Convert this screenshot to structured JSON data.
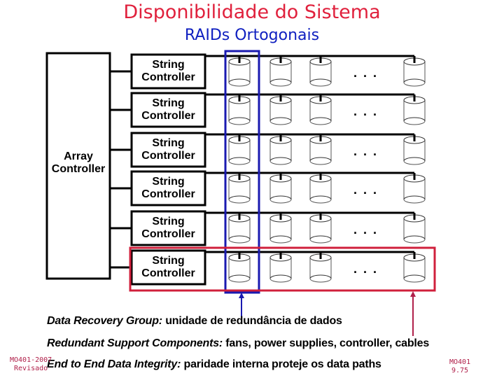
{
  "title": "Disponibilidade do Sistema",
  "subtitle": "RAIDs Ortogonais",
  "array_controller": {
    "label_line1": "Array",
    "label_line2": "Controller"
  },
  "string_controllers": [
    {
      "line1": "String",
      "line2": "Controller"
    },
    {
      "line1": "String",
      "line2": "Controller"
    },
    {
      "line1": "String",
      "line2": "Controller"
    },
    {
      "line1": "String",
      "line2": "Controller"
    },
    {
      "line1": "String",
      "line2": "Controller"
    },
    {
      "line1": "String",
      "line2": "Controller"
    }
  ],
  "disk_row": {
    "visible_disks_before_ellipsis": 3,
    "ellipsis": ". . .",
    "disks_after_ellipsis": 1
  },
  "highlights": {
    "column_group_color": "#1a1ab0",
    "row_group_color": "#d0203c"
  },
  "captions": [
    {
      "term": "Data Recovery Group:",
      "text": " unidade de redundância de dados"
    },
    {
      "term": "Redundant Support Components:",
      "text": " fans, power supplies, controller, cables"
    },
    {
      "term": "End to End Data Integrity:",
      "text": " paridade interna proteje os data paths"
    }
  ],
  "footer": {
    "left_line1": "MO401-2007",
    "left_line2": "Revisado",
    "right_line1": "MO401",
    "right_line2": "9.75"
  }
}
